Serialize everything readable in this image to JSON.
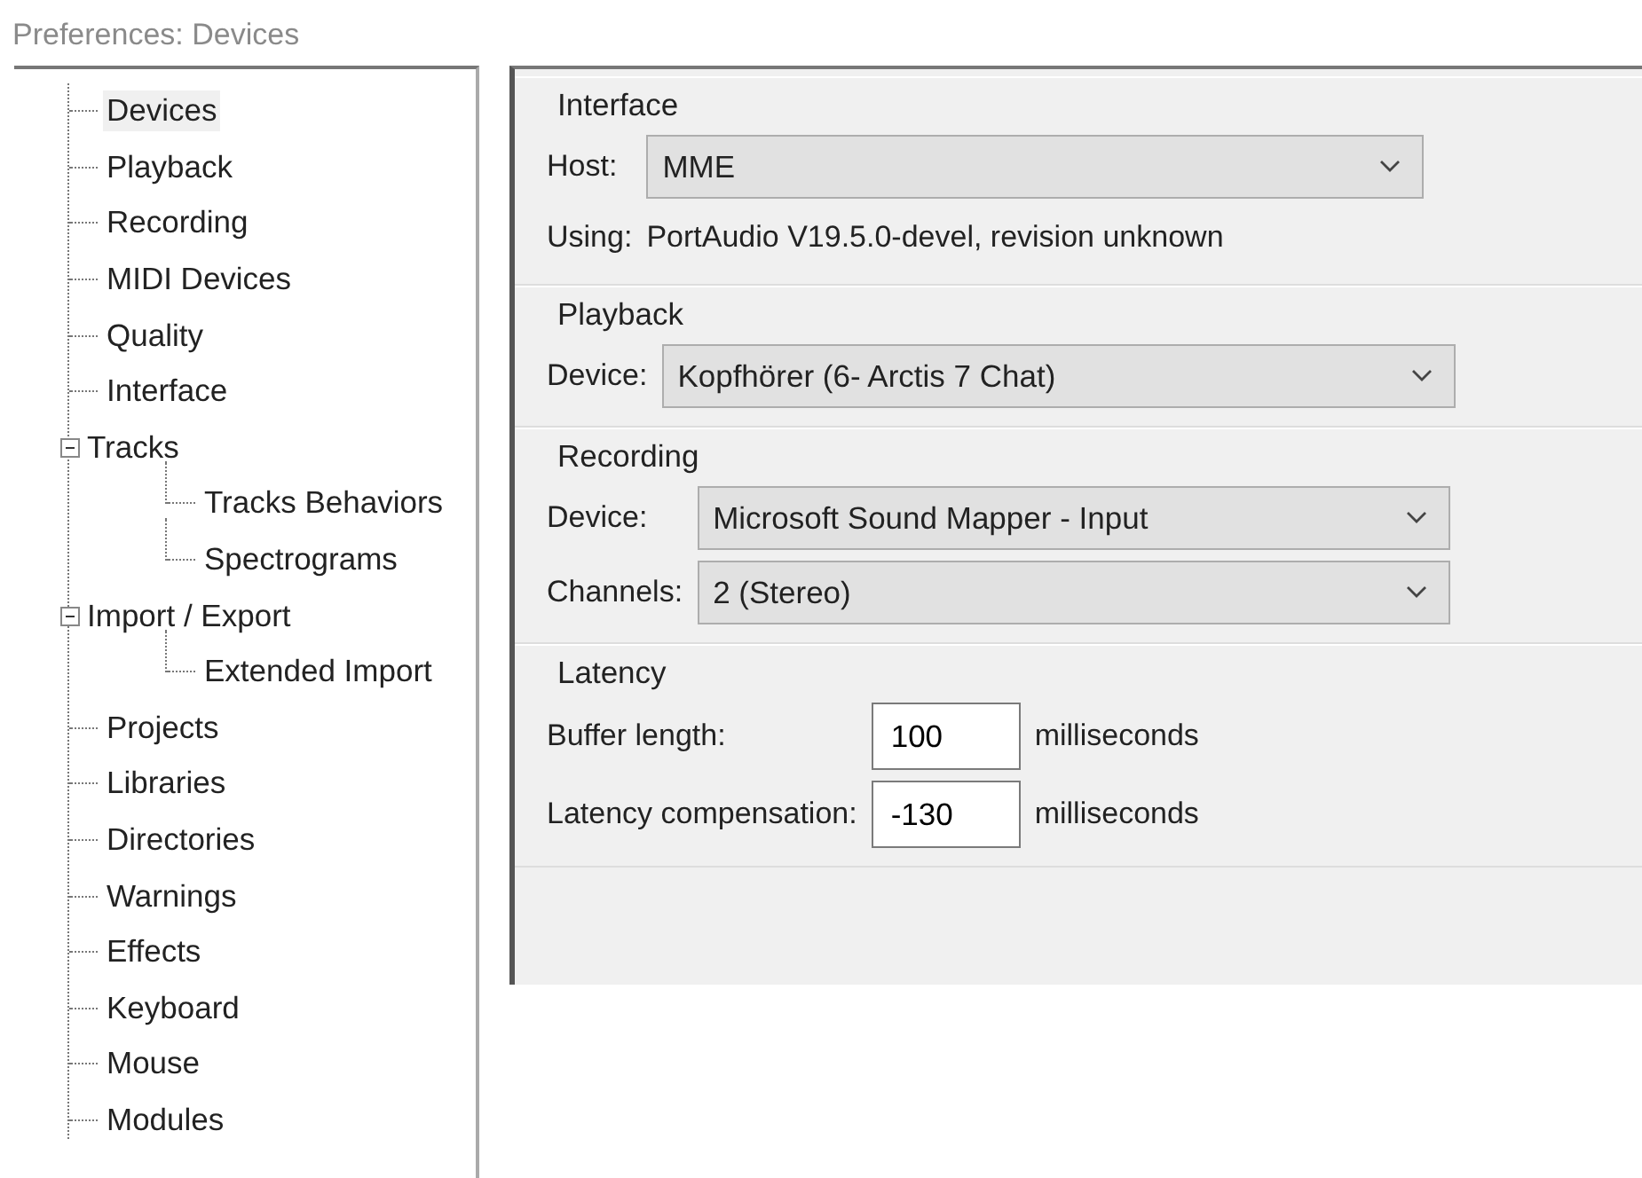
{
  "window": {
    "title": "Preferences: Devices"
  },
  "tree": [
    {
      "label": "Devices",
      "selected": true
    },
    {
      "label": "Playback",
      "selected": false
    },
    {
      "label": "Recording",
      "selected": false
    },
    {
      "label": "MIDI Devices",
      "selected": false
    },
    {
      "label": "Quality",
      "selected": false
    },
    {
      "label": "Interface",
      "selected": false
    },
    {
      "label": "Tracks",
      "selected": false,
      "expanded": true,
      "children": [
        {
          "label": "Tracks Behaviors",
          "selected": false
        },
        {
          "label": "Spectrograms",
          "selected": false
        }
      ]
    },
    {
      "label": "Import / Export",
      "selected": false,
      "expanded": true,
      "children": [
        {
          "label": "Extended Import",
          "selected": false
        }
      ]
    },
    {
      "label": "Projects",
      "selected": false
    },
    {
      "label": "Libraries",
      "selected": false
    },
    {
      "label": "Directories",
      "selected": false
    },
    {
      "label": "Warnings",
      "selected": false
    },
    {
      "label": "Effects",
      "selected": false
    },
    {
      "label": "Keyboard",
      "selected": false
    },
    {
      "label": "Mouse",
      "selected": false
    },
    {
      "label": "Modules",
      "selected": false
    }
  ],
  "groups": [
    {
      "title": "Interface",
      "rows": [
        {
          "kind": "dropdown",
          "label": "Host:",
          "value": "MME"
        },
        {
          "kind": "text",
          "label": "Using:",
          "value": "PortAudio V19.5.0-devel, revision unknown"
        }
      ]
    },
    {
      "title": "Playback",
      "rows": [
        {
          "kind": "dropdown",
          "label": "Device:",
          "value": "Kopfhörer (6- Arctis 7 Chat)"
        }
      ]
    },
    {
      "title": "Recording",
      "rows": [
        {
          "kind": "dropdown",
          "label": "Device:",
          "value": "Microsoft Sound Mapper - Input"
        },
        {
          "kind": "dropdown",
          "label": "Channels:",
          "value": "2 (Stereo)"
        }
      ]
    },
    {
      "title": "Latency",
      "rows": [
        {
          "kind": "number",
          "label": "Buffer length:",
          "value": "100",
          "unit": "milliseconds"
        },
        {
          "kind": "number",
          "label": "Latency compensation:",
          "value": "-130",
          "unit": "milliseconds"
        }
      ]
    }
  ]
}
